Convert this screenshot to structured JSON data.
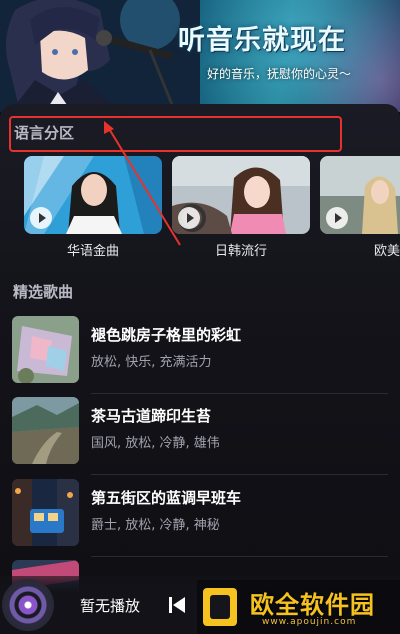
{
  "hero": {
    "title": "听音乐就现在",
    "subtitle": "好的音乐，抚慰你的心灵～"
  },
  "language_section": {
    "title": "语言分区",
    "cards": [
      {
        "label": "华语金曲"
      },
      {
        "label": "日韩流行"
      },
      {
        "label": "欧美"
      }
    ]
  },
  "featured_section": {
    "title": "精选歌曲",
    "songs": [
      {
        "title": "褪色跳房子格里的彩虹",
        "tags": "放松, 快乐, 充满活力"
      },
      {
        "title": "茶马古道蹄印生苔",
        "tags": "国风, 放松, 冷静, 雄伟"
      },
      {
        "title": "第五街区的蓝调早班车",
        "tags": "爵士, 放松, 冷静, 神秘"
      }
    ]
  },
  "player": {
    "now_playing": "暂无播放"
  },
  "watermark": {
    "text": "欧全软件园",
    "url": "www.apoujin.com"
  },
  "colors": {
    "highlight": "#e8322c",
    "accent_watermark": "#f5c21f"
  }
}
